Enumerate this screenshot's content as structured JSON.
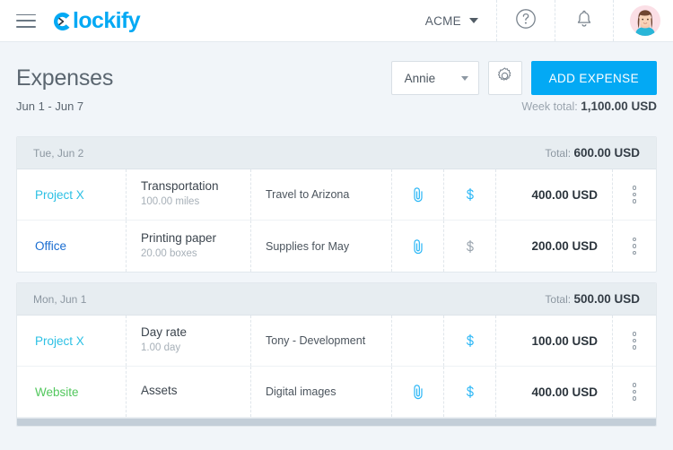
{
  "topbar": {
    "menu_icon": "hamburger-icon",
    "brand": "lockify",
    "brand_full": "Clockify",
    "workspace": "ACME",
    "help_icon": "question-circle-icon",
    "notifications_icon": "bell-icon",
    "avatar_icon": "user-avatar"
  },
  "header": {
    "title": "Expenses",
    "user_filter": "Annie",
    "settings_icon": "gear-icon",
    "add_expense_label": "ADD EXPENSE",
    "date_range": "Jun 1 - Jun 7",
    "week_total_label": "Week total:",
    "week_total_value": "1,100.00 USD"
  },
  "colors": {
    "accent": "#03a9f4",
    "project_cyan": "#2cc0e4",
    "project_blue": "#1a6dd1",
    "project_green": "#52c75d",
    "group_header_bg": "#e7edf1",
    "page_bg": "#f1f5f9"
  },
  "groups": [
    {
      "date": "Tue, Jun 2",
      "total_label": "Total:",
      "total_value": "600.00 USD",
      "rows": [
        {
          "project": "Project X",
          "project_color": "cyan",
          "category": "Transportation",
          "quantity": "100.00 miles",
          "note": "Travel to Arizona",
          "attachment": "paperclip-icon",
          "attachment_active": true,
          "billable": "dollar-icon",
          "billable_active": true,
          "amount": "400.00 USD",
          "menu": "kebab-menu-icon"
        },
        {
          "project": "Office",
          "project_color": "blue",
          "category": "Printing paper",
          "quantity": "20.00 boxes",
          "note": "Supplies for May",
          "attachment": "paperclip-icon",
          "attachment_active": true,
          "billable": "dollar-icon",
          "billable_active": false,
          "amount": "200.00 USD",
          "menu": "kebab-menu-icon"
        }
      ]
    },
    {
      "date": "Mon, Jun 1",
      "total_label": "Total:",
      "total_value": "500.00 USD",
      "rows": [
        {
          "project": "Project X",
          "project_color": "cyan",
          "category": "Day rate",
          "quantity": "1.00 day",
          "note": "Tony - Development",
          "attachment": "",
          "attachment_active": false,
          "billable": "dollar-icon",
          "billable_active": true,
          "amount": "100.00 USD",
          "menu": "kebab-menu-icon"
        },
        {
          "project": "Website",
          "project_color": "green",
          "category": "Assets",
          "quantity": "",
          "note": "Digital images",
          "attachment": "paperclip-icon",
          "attachment_active": true,
          "billable": "dollar-icon",
          "billable_active": true,
          "amount": "400.00 USD",
          "menu": "kebab-menu-icon"
        }
      ]
    }
  ]
}
